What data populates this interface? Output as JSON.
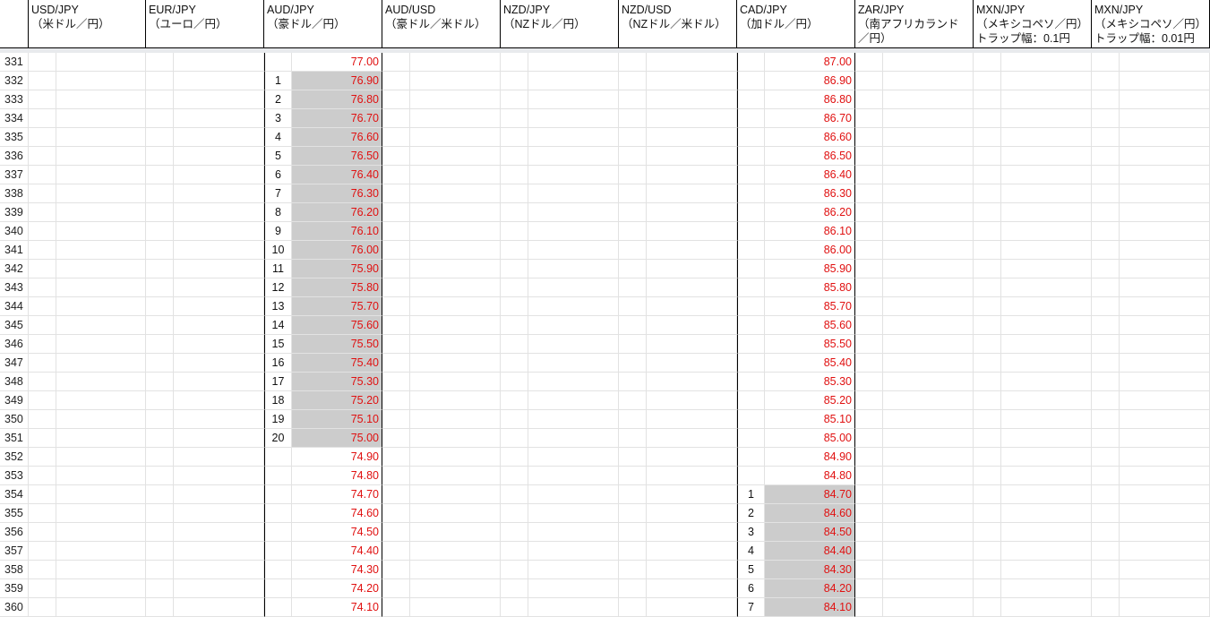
{
  "headers": [
    {
      "line1": "USD/JPY",
      "line2": "（米ドル／円）"
    },
    {
      "line1": "EUR/JPY",
      "line2": "（ユーロ／円）"
    },
    {
      "line1": "AUD/JPY",
      "line2": "（豪ドル／円）"
    },
    {
      "line1": "AUD/USD",
      "line2": "（豪ドル／米ドル）"
    },
    {
      "line1": "NZD/JPY",
      "line2": "（NZドル／円）"
    },
    {
      "line1": "NZD/USD",
      "line2": "（NZドル／米ドル）"
    },
    {
      "line1": "CAD/JPY",
      "line2": "（加ドル／円）"
    },
    {
      "line1": "ZAR/JPY",
      "line2": "（南アフリカランド",
      "line3": "／円）"
    },
    {
      "line1": "MXN/JPY",
      "line2": "（メキシコペソ／円）",
      "line3": "トラップ幅：0.1円"
    },
    {
      "line1": "MXN/JPY",
      "line2": "（メキシコペソ／円）",
      "line3": "トラップ幅：0.01円"
    }
  ],
  "row_numbers": [
    "331",
    "332",
    "333",
    "334",
    "335",
    "336",
    "337",
    "338",
    "339",
    "340",
    "341",
    "342",
    "343",
    "344",
    "345",
    "346",
    "347",
    "348",
    "349",
    "350",
    "351",
    "352",
    "353",
    "354",
    "355",
    "356",
    "357",
    "358",
    "359",
    "360"
  ],
  "aud_jpy": {
    "counts": [
      "",
      "1",
      "2",
      "3",
      "4",
      "5",
      "6",
      "7",
      "8",
      "9",
      "10",
      "11",
      "12",
      "13",
      "14",
      "15",
      "16",
      "17",
      "18",
      "19",
      "20",
      "",
      "",
      "",
      "",
      "",
      "",
      "",
      "",
      ""
    ],
    "prices": [
      "77.00",
      "76.90",
      "76.80",
      "76.70",
      "76.60",
      "76.50",
      "76.40",
      "76.30",
      "76.20",
      "76.10",
      "76.00",
      "75.90",
      "75.80",
      "75.70",
      "75.60",
      "75.50",
      "75.40",
      "75.30",
      "75.20",
      "75.10",
      "75.00",
      "74.90",
      "74.80",
      "74.70",
      "74.60",
      "74.50",
      "74.40",
      "74.30",
      "74.20",
      "74.10"
    ]
  },
  "cad_jpy": {
    "counts": [
      "",
      "",
      "",
      "",
      "",
      "",
      "",
      "",
      "",
      "",
      "",
      "",
      "",
      "",
      "",
      "",
      "",
      "",
      "",
      "",
      "",
      "",
      "",
      "1",
      "2",
      "3",
      "4",
      "5",
      "6",
      "7"
    ],
    "prices": [
      "87.00",
      "86.90",
      "86.80",
      "86.70",
      "86.60",
      "86.50",
      "86.40",
      "86.30",
      "86.20",
      "86.10",
      "86.00",
      "85.90",
      "85.80",
      "85.70",
      "85.60",
      "85.50",
      "85.40",
      "85.30",
      "85.20",
      "85.10",
      "85.00",
      "84.90",
      "84.80",
      "84.70",
      "84.60",
      "84.50",
      "84.40",
      "84.30",
      "84.20",
      "84.10"
    ]
  },
  "colors": {
    "price_text": "#e01010",
    "highlight_fill": "#cccccc",
    "gridline": "#e2e2e2",
    "header_border": "#000000"
  }
}
